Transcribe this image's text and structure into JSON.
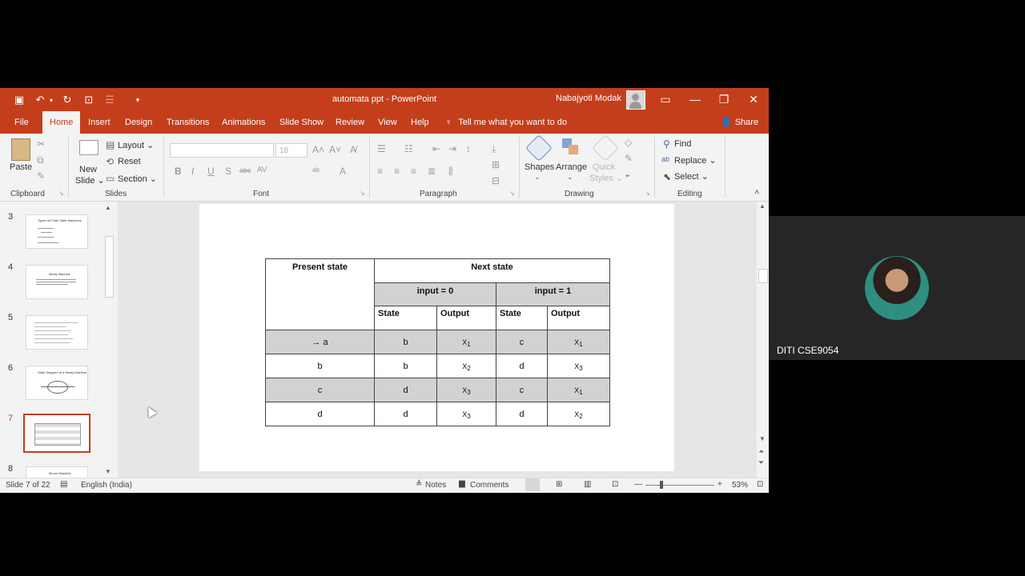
{
  "window": {
    "title": "automata ppt  -  PowerPoint",
    "user": "Nabajyoti Modak",
    "controls": {
      "ribbon_display": "▭",
      "minimize": "—",
      "restore": "❐",
      "close": "✕"
    }
  },
  "quick_access": {
    "save_icon": "save-icon",
    "undo_icon": "undo-icon",
    "redo_icon": "redo-icon"
  },
  "tabs": [
    "File",
    "Home",
    "Insert",
    "Design",
    "Transitions",
    "Animations",
    "Slide Show",
    "Review",
    "View",
    "Help"
  ],
  "active_tab": "Home",
  "tell_me": "Tell me what you want to do",
  "share": "Share",
  "ribbon": {
    "clipboard": {
      "paste": "Paste",
      "label": "Clipboard"
    },
    "slides": {
      "new_slide_1": "New",
      "new_slide_2": "Slide ⌄",
      "layout": "Layout ⌄",
      "reset": "Reset",
      "section": "Section ⌄",
      "label": "Slides"
    },
    "font": {
      "size": "18",
      "label": "Font",
      "buttons": [
        "B",
        "I",
        "U",
        "S",
        "abc",
        "AV",
        "A"
      ]
    },
    "paragraph": {
      "label": "Paragraph"
    },
    "drawing": {
      "shapes": "Shapes",
      "arrange": "Arrange",
      "quick_1": "Quick",
      "quick_2": "Styles ⌄",
      "label": "Drawing"
    },
    "editing": {
      "find": "Find",
      "replace": "Replace ⌄",
      "select": "Select ⌄",
      "label": "Editing"
    }
  },
  "thumbnails": [
    {
      "num": "3",
      "title": "Types of Finite State Machines"
    },
    {
      "num": "4",
      "title": "Mealy Machine"
    },
    {
      "num": "5",
      "title": ""
    },
    {
      "num": "6",
      "title": "State Diagram of a Mealy Machine"
    },
    {
      "num": "7",
      "title": ""
    },
    {
      "num": "8",
      "title": "Moore Machine"
    }
  ],
  "selected_slide": "7",
  "slide_table": {
    "header_present": "Present state",
    "header_next": "Next state",
    "input0": "input = 0",
    "input1": "input = 1",
    "col_state": "State",
    "col_output": "Output",
    "rows": [
      {
        "present": "→ a",
        "s0": "b",
        "o0": "X",
        "o0sub": "1",
        "s1": "c",
        "o1": "X",
        "o1sub": "1",
        "shaded": true
      },
      {
        "present": "b",
        "s0": "b",
        "o0": "X",
        "o0sub": "2",
        "s1": "d",
        "o1": "X",
        "o1sub": "3",
        "shaded": false
      },
      {
        "present": "c",
        "s0": "d",
        "o0": "X",
        "o0sub": "3",
        "s1": "c",
        "o1": "X",
        "o1sub": "1",
        "shaded": true
      },
      {
        "present": "d",
        "s0": "d",
        "o0": "X",
        "o0sub": "3",
        "s1": "d",
        "o1": "X",
        "o1sub": "2",
        "shaded": false
      }
    ]
  },
  "status": {
    "slide_info": "Slide 7 of 22",
    "language": "English (India)",
    "notes": "Notes",
    "comments": "Comments",
    "zoom": "53%"
  },
  "webcam": {
    "name": "DITI CSE9054"
  }
}
